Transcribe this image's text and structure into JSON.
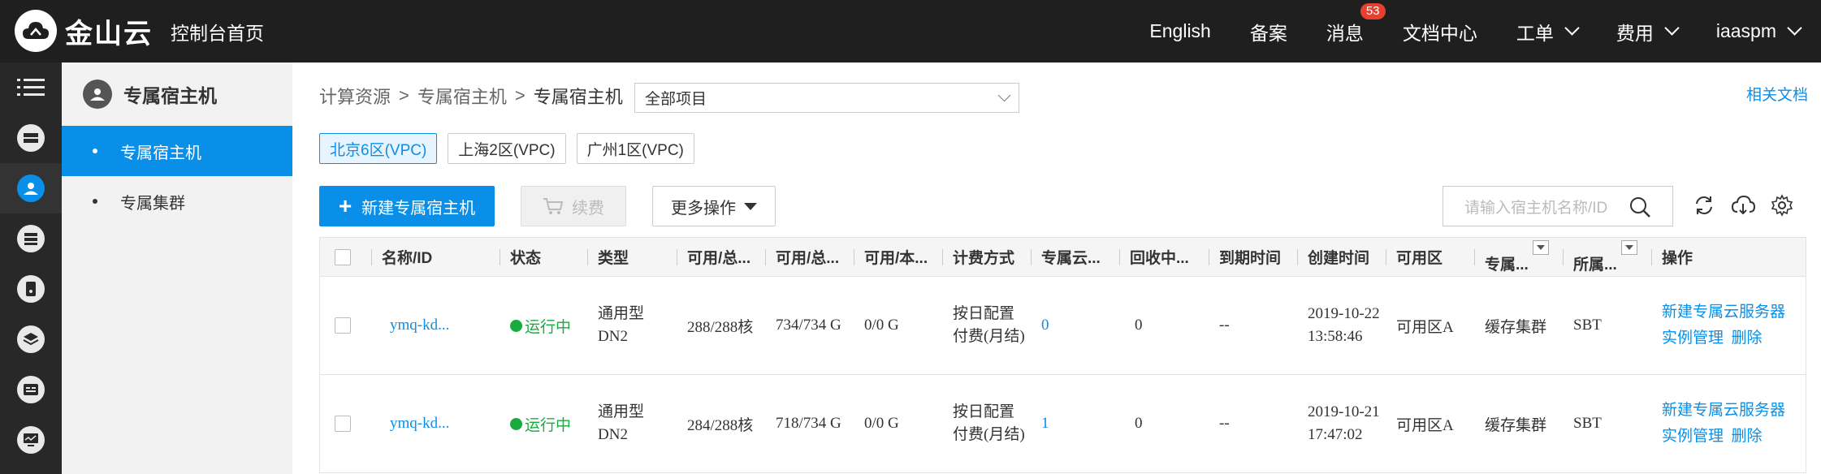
{
  "topbar": {
    "logo_text": "金山云",
    "console_home": "控制台首页",
    "items": [
      {
        "label": "English"
      },
      {
        "label": "备案"
      },
      {
        "label": "消息",
        "badge": "53"
      },
      {
        "label": "文档中心"
      },
      {
        "label": "工单"
      },
      {
        "label": "费用"
      },
      {
        "label": "iaaspm"
      }
    ]
  },
  "rail": {
    "icons": [
      "menu-icon",
      "compute-icon",
      "dedicated-host-icon",
      "database-icon",
      "storage-icon",
      "layers-icon",
      "id-card-icon",
      "monitor-icon"
    ]
  },
  "sidebar": {
    "title": "专属宿主机",
    "items": [
      {
        "label": "专属宿主机",
        "active": true
      },
      {
        "label": "专属集群",
        "active": false
      }
    ]
  },
  "breadcrumb": {
    "items": [
      "计算资源",
      ">",
      "专属宿主机",
      ">",
      "专属宿主机"
    ]
  },
  "project_select": {
    "value": "全部项目"
  },
  "related_docs": "相关文档",
  "regions": [
    {
      "label": "北京6区(VPC)",
      "active": true
    },
    {
      "label": "上海2区(VPC)",
      "active": false
    },
    {
      "label": "广州1区(VPC)",
      "active": false
    }
  ],
  "toolbar": {
    "new_label": "新建专属宿主机",
    "renew_label": "续费",
    "more_label": "更多操作",
    "search_placeholder": "请输入宿主机名称/ID"
  },
  "table": {
    "headers": [
      "名称/ID",
      "状态",
      "类型",
      "可用/总...",
      "可用/总...",
      "可用/本...",
      "计费方式",
      "专属云...",
      "回收中...",
      "到期时间",
      "创建时间",
      "可用区",
      "专属...",
      "所属...",
      "操作"
    ],
    "rows": [
      {
        "name": "ymq-kd...",
        "status": "运行中",
        "type": "通用型 DN2",
        "cpu": "288/288核",
        "mem": "734/734 G",
        "disk": "0/0 G",
        "billing": "按日配置付费(月结)",
        "instances": "0",
        "recycling": "0",
        "expire": "--",
        "created": "2019-10-22 13:58:46",
        "zone": "可用区A",
        "cluster": "缓存集群",
        "project": "SBT",
        "op_new": "新建专属云服务器",
        "op_manage": "实例管理",
        "op_delete": "删除"
      },
      {
        "name": "ymq-kd...",
        "status": "运行中",
        "type": "通用型 DN2",
        "cpu": "284/288核",
        "mem": "718/734 G",
        "disk": "0/0 G",
        "billing": "按日配置付费(月结)",
        "instances": "1",
        "recycling": "0",
        "expire": "--",
        "created": "2019-10-21 17:47:02",
        "zone": "可用区A",
        "cluster": "缓存集群",
        "project": "SBT",
        "op_new": "新建专属云服务器",
        "op_manage": "实例管理",
        "op_delete": "删除"
      }
    ]
  },
  "colors": {
    "accent": "#0a8fe8",
    "topbar": "#1f1f1f",
    "running": "#1aab40",
    "badge": "#e8402f"
  }
}
